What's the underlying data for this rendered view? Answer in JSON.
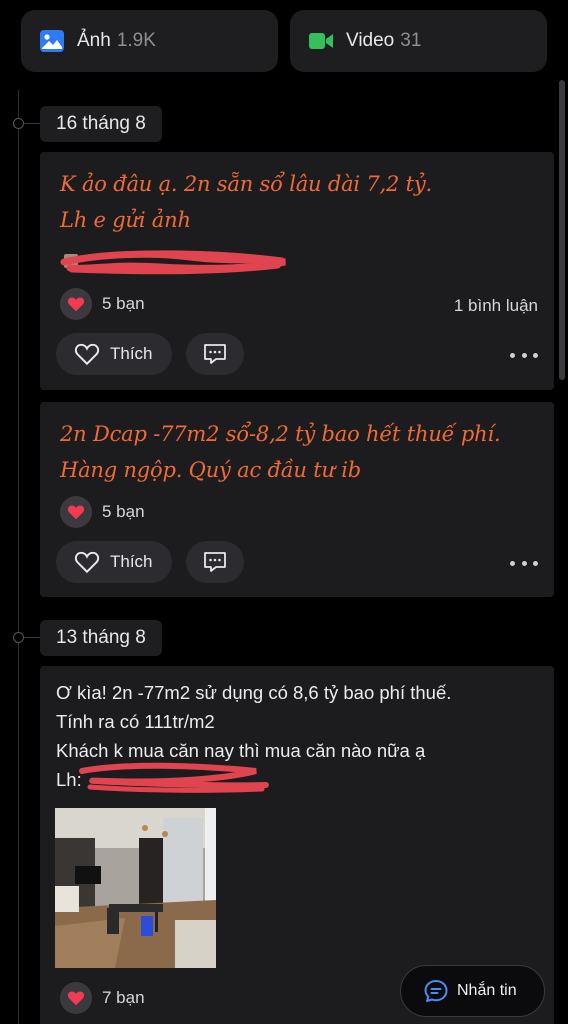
{
  "tabs": {
    "photos": {
      "label": "Ảnh",
      "count": "1.9K",
      "icon": "image-icon"
    },
    "videos": {
      "label": "Video",
      "count": "31",
      "icon": "video-icon"
    }
  },
  "groups": [
    {
      "date": "16 tháng 8",
      "posts": [
        {
          "lines": [
            "K ảo đâu ạ. 2n sẵn sổ lâu dài 7,2 tỷ.",
            "Lh e gửi ảnh"
          ],
          "reactions": "5 bạn",
          "comments": "1 bình luận",
          "like_label": "Thích"
        },
        {
          "lines": [
            "2n Dcap -77m2 sổ-8,2 tỷ bao hết thuế phí.",
            "Hàng ngộp. Quý ac đầu tư ib"
          ],
          "reactions": "5 bạn",
          "like_label": "Thích"
        }
      ]
    },
    {
      "date": "13 tháng 8",
      "posts": [
        {
          "lines": [
            "Ơ kìa! 2n -77m2 sử dụng có 8,6 tỷ bao phí thuế.",
            "Tính ra có 111tr/m2",
            "Khách k mua căn nay thì mua căn nào nữa ạ",
            "Lh:"
          ],
          "reactions": "7 bạn"
        }
      ]
    }
  ],
  "message_button": {
    "label": "Nhắn tin",
    "icon": "chat-icon"
  },
  "colors": {
    "accent_text": "#f06a35",
    "background": "#000000",
    "card": "#1c1c1f",
    "redaction": "#e0454f"
  }
}
